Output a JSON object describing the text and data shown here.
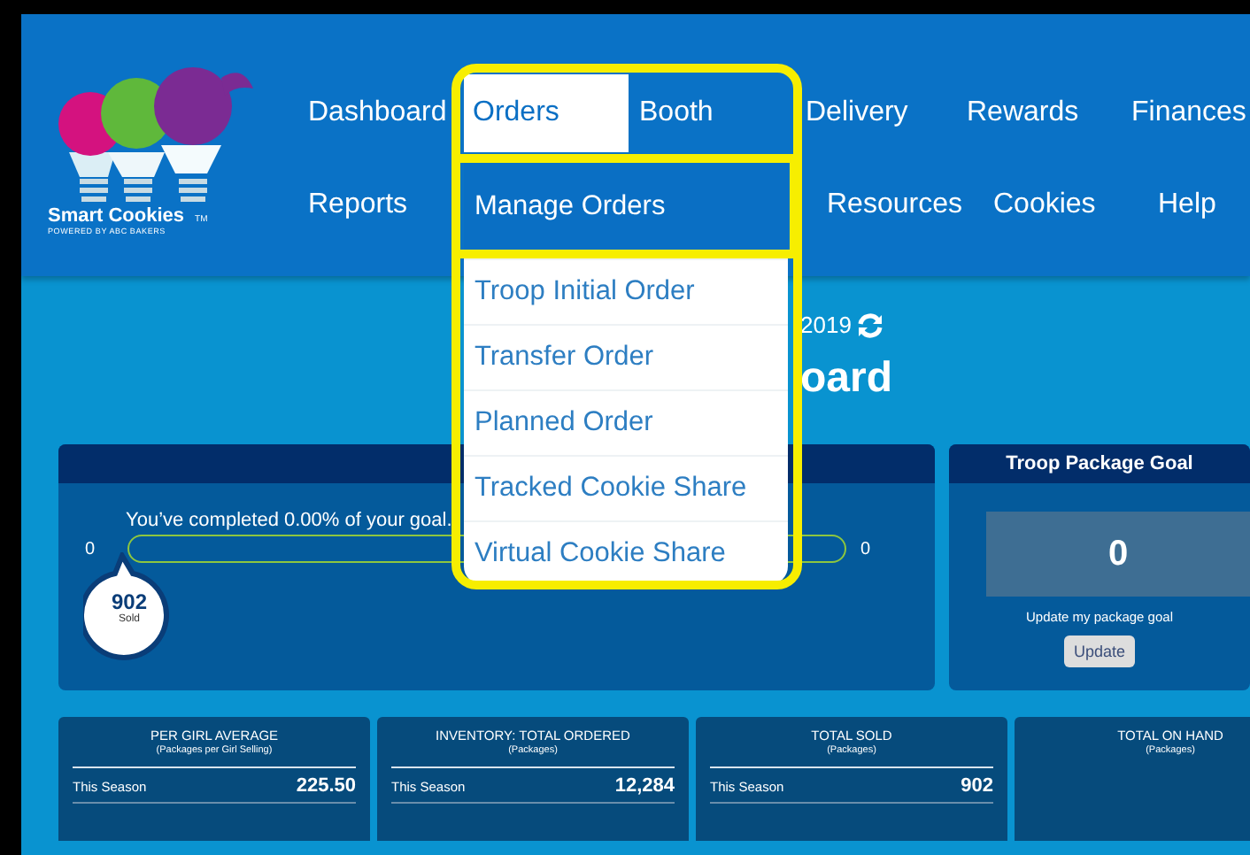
{
  "logo": {
    "name": "Smart Cookies",
    "mark": "TM",
    "tagline": "POWERED BY ABC BAKERS"
  },
  "nav": {
    "row_1": [
      {
        "label": "Dashboard",
        "selected": false
      },
      {
        "label": "Orders",
        "selected": true
      },
      {
        "label": "Booth",
        "selected": false
      },
      {
        "label": "Delivery",
        "selected": false
      },
      {
        "label": "Rewards",
        "selected": false
      },
      {
        "label": "Finances",
        "selected": false
      }
    ],
    "row_2": [
      {
        "label": "Reports",
        "selected": false
      },
      {
        "label": "Resources",
        "selected": false
      },
      {
        "label": "Cookies",
        "selected": false
      },
      {
        "label": "Help",
        "selected": false
      }
    ]
  },
  "dropdown": [
    {
      "label": "Manage Orders",
      "selected": true
    },
    {
      "label": "Troop Initial Order",
      "selected": false
    },
    {
      "label": "Transfer Order",
      "selected": false
    },
    {
      "label": "Planned Order",
      "selected": false
    },
    {
      "label": "Tracked Cookie Share",
      "selected": false
    },
    {
      "label": "Virtual Cookie Share",
      "selected": false
    }
  ],
  "page": {
    "date": "2019",
    "title": "oard"
  },
  "goal": {
    "message": "You’ve completed 0.00% of your goal.",
    "min": "0",
    "max": "0",
    "level": 0,
    "sold": "902",
    "sold_label": "Sold"
  },
  "troop_goal": {
    "title": "Troop Package Goal",
    "value": "0",
    "prompt": "Update my package goal",
    "button": "Update"
  },
  "stats": [
    {
      "title": "PER GIRL AVERAGE",
      "subtitle": "(Packages per Girl Selling)",
      "row_label": "This Season",
      "value": "225.50"
    },
    {
      "title": "INVENTORY: TOTAL ORDERED",
      "subtitle": "(Packages)",
      "row_label": "This Season",
      "value": "12,284"
    },
    {
      "title": "TOTAL SOLD",
      "subtitle": "(Packages)",
      "row_label": "This Season",
      "value": "902"
    },
    {
      "title": "TOTAL ON HAND",
      "subtitle": "(Packages)"
    }
  ]
}
